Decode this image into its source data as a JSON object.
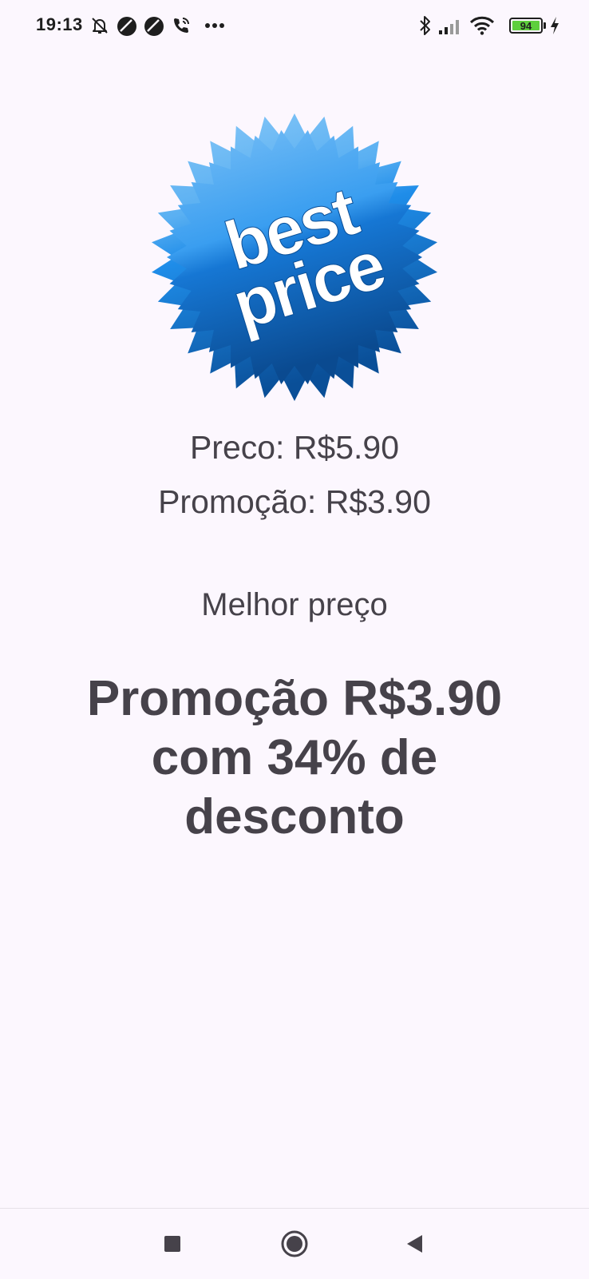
{
  "status_bar": {
    "time": "19:13",
    "battery_level": "94",
    "icons": [
      "notifications-off-icon",
      "app-circle-icon",
      "app-circle-icon",
      "wifi-calling-icon",
      "more-dots-icon",
      "bluetooth-icon",
      "signal-icon",
      "wifi-icon",
      "battery-icon",
      "charging-icon"
    ]
  },
  "badge": {
    "line1": "best",
    "line2": "price",
    "colors": {
      "light": "#6db8f4",
      "mid": "#1f8de9",
      "dark": "#0a4f98"
    }
  },
  "prices": {
    "regular": "Preco: R$5.90",
    "promo": "Promoção: R$3.90"
  },
  "best_label": "Melhor preço",
  "summary": "Promoção R$3.90 com 34% de desconto",
  "nav_bar": {
    "buttons": [
      "recents-button",
      "home-button",
      "back-button"
    ]
  }
}
